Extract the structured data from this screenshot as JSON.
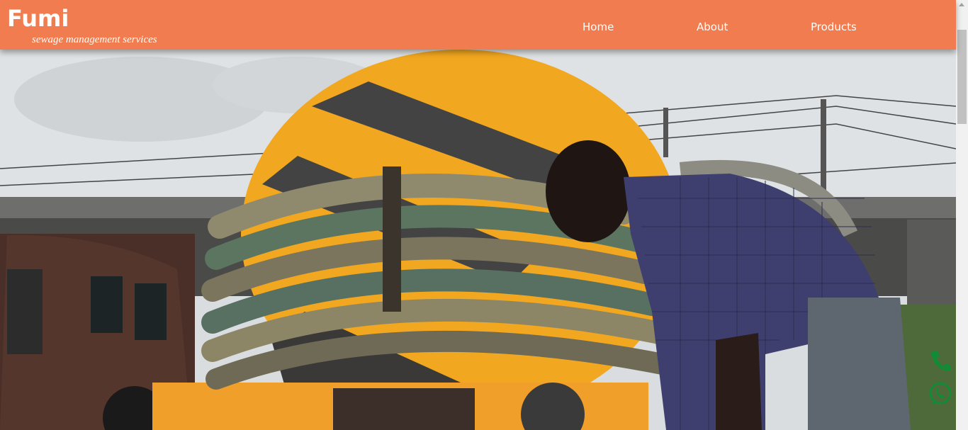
{
  "header": {
    "brand": "Fumi",
    "tagline": "sewage management services"
  },
  "nav": {
    "items": [
      "Home",
      "About",
      "Products"
    ]
  },
  "hero": {
    "image": "sewage-truck-hose-worker"
  },
  "floating": {
    "icons": [
      "phone-icon",
      "whatsapp-icon"
    ],
    "color": "#138a36"
  },
  "colors": {
    "header": "#f07c4f",
    "text": "#ffffff"
  }
}
